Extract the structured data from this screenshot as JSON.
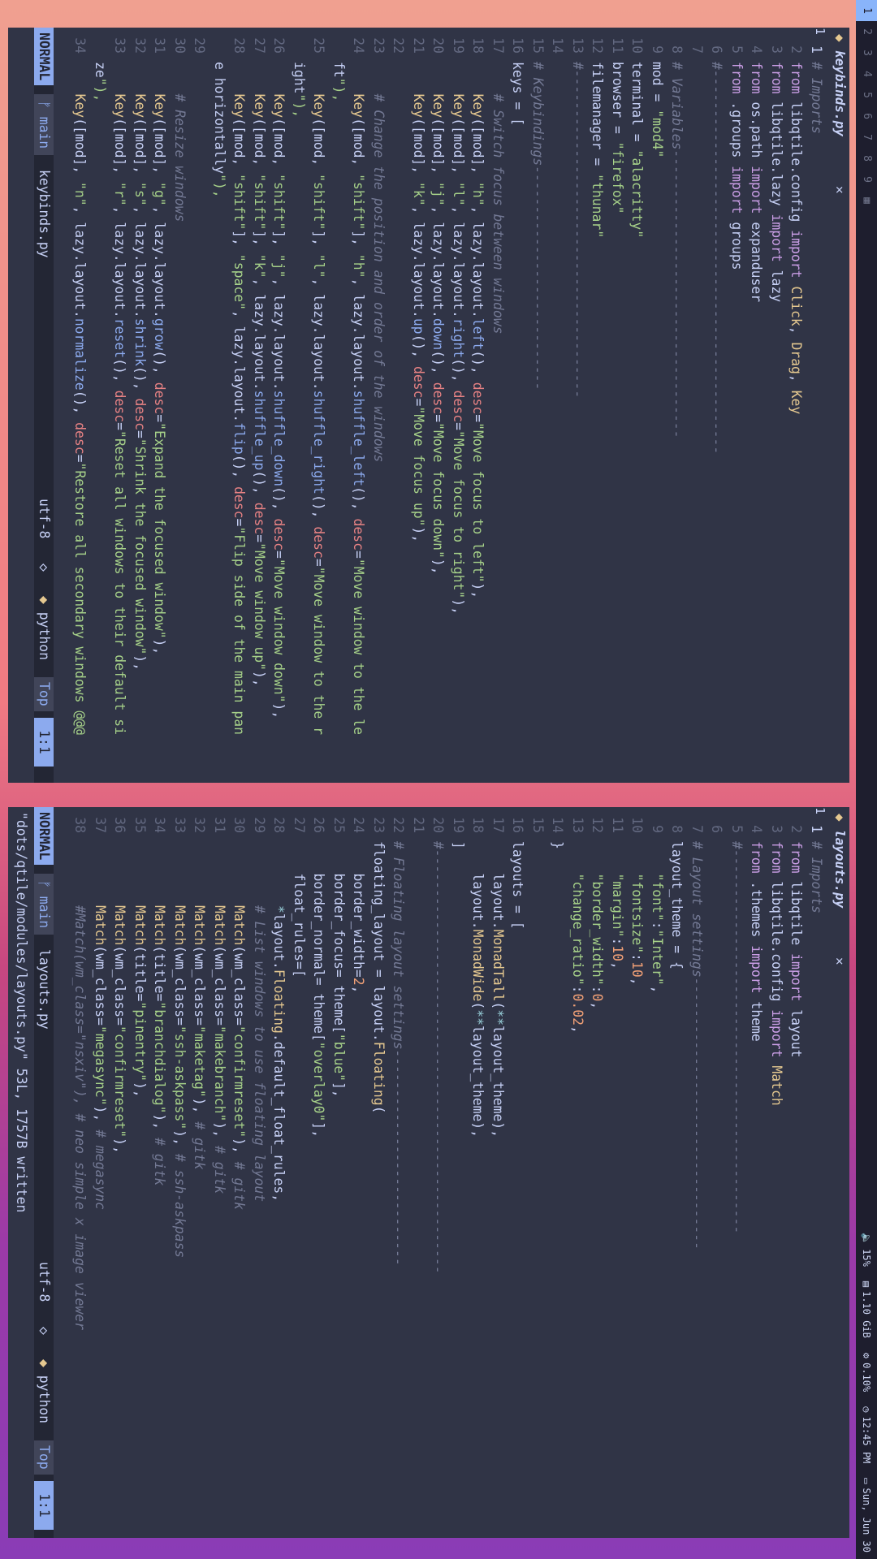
{
  "bar": {
    "workspaces": [
      "1",
      "2",
      "3",
      "4",
      "5",
      "6",
      "7",
      "8",
      "9"
    ],
    "active_workspace": "1",
    "layout_icon": "layout-icon",
    "volume": "15%",
    "memory": "1.10 GiB",
    "cpu": "0.10%",
    "time": "12:45 PM",
    "date": "Sun, Jun 30"
  },
  "left": {
    "tab_title": "keybinds.py",
    "close_glyph": "✕",
    "lines": [
      {
        "n": "1",
        "t": "# Imports"
      },
      {
        "n": "2",
        "t": "from libqtile.config import Click, Drag, Key"
      },
      {
        "n": "3",
        "t": "from libqtile.lazy import lazy"
      },
      {
        "n": "4",
        "t": "from os.path import expanduser"
      },
      {
        "n": "5",
        "t": "from .groups import groups"
      },
      {
        "n": "6",
        "t": "#------------------------------------------------"
      },
      {
        "n": "7",
        "t": ""
      },
      {
        "n": "8",
        "t": "# Variables------------------------------------"
      },
      {
        "n": "9",
        "t": "mod = \"mod4\""
      },
      {
        "n": "10",
        "t": "terminal = \"alacritty\""
      },
      {
        "n": "11",
        "t": "browser = \"firefox\""
      },
      {
        "n": "12",
        "t": "filemanager = \"thunar\""
      },
      {
        "n": "13",
        "t": "#-----------------------------------------"
      },
      {
        "n": "14",
        "t": ""
      },
      {
        "n": "15",
        "t": "# Keybindings----------------------------"
      },
      {
        "n": "16",
        "t": "keys = ["
      },
      {
        "n": "17",
        "t": "    # Switch focus between windows"
      },
      {
        "n": "18",
        "t": "    Key([mod], \"h\", lazy.layout.left(), desc=\"Move focus to left\"),"
      },
      {
        "n": "19",
        "t": "    Key([mod], \"l\", lazy.layout.right(), desc=\"Move focus to right\"),"
      },
      {
        "n": "20",
        "t": "    Key([mod], \"j\", lazy.layout.down(), desc=\"Move focus down\"),"
      },
      {
        "n": "21",
        "t": "    Key([mod], \"k\", lazy.layout.up(), desc=\"Move focus up\"),"
      },
      {
        "n": "22",
        "t": ""
      },
      {
        "n": "23",
        "t": "    # Change the position and order of the windows"
      },
      {
        "n": "24",
        "t": "    Key([mod, \"shift\"], \"h\", lazy.layout.shuffle_left(), desc=\"Move window to the le"
      },
      {
        "n": "",
        "t": "ft\"),"
      },
      {
        "n": "25",
        "t": "    Key([mod, \"shift\"], \"l\", lazy.layout.shuffle_right(), desc=\"Move window to the r"
      },
      {
        "n": "",
        "t": "ight\"),"
      },
      {
        "n": "26",
        "t": "    Key([mod, \"shift\"], \"j\", lazy.layout.shuffle_down(), desc=\"Move window down\"),"
      },
      {
        "n": "27",
        "t": "    Key([mod, \"shift\"], \"k\", lazy.layout.shuffle_up(), desc=\"Move window up\"),"
      },
      {
        "n": "28",
        "t": "    Key([mod, \"shift\"], \"space\", lazy.layout.flip(), desc=\"Flip side of the main pan"
      },
      {
        "n": "",
        "t": "e horizontally\"),"
      },
      {
        "n": "29",
        "t": ""
      },
      {
        "n": "30",
        "t": "    # Resize windows"
      },
      {
        "n": "31",
        "t": "    Key([mod], \"g\", lazy.layout.grow(), desc=\"Expand the focused window\"),"
      },
      {
        "n": "32",
        "t": "    Key([mod], \"s\", lazy.layout.shrink(), desc=\"Shrink the focused window\"),"
      },
      {
        "n": "33",
        "t": "    Key([mod], \"r\", lazy.layout.reset(), desc=\"Reset all windows to their default si"
      },
      {
        "n": "",
        "t": "ze\"),"
      },
      {
        "n": "34",
        "t": "    Key([mod], \"n\", lazy.layout.normalize(), desc=\"Restore all secondary windows @@@"
      }
    ],
    "status": {
      "mode": "NORMAL",
      "branch": "main",
      "file": "keybinds.py",
      "encoding": "utf-8",
      "filetype": "python",
      "scroll": "Top",
      "pos": "1:1"
    },
    "cmd": ""
  },
  "right": {
    "tab_title": "layouts.py",
    "close_glyph": "✕",
    "lines": [
      {
        "n": "1",
        "t": "# Imports"
      },
      {
        "n": "2",
        "t": "from libqtile import layout"
      },
      {
        "n": "3",
        "t": "from libqtile.config import Match"
      },
      {
        "n": "4",
        "t": "from .themes import theme"
      },
      {
        "n": "5",
        "t": "#------------------------------------------------"
      },
      {
        "n": "6",
        "t": ""
      },
      {
        "n": "7",
        "t": "# Layout settings----------------------------------"
      },
      {
        "n": "8",
        "t": "layout_theme = {"
      },
      {
        "n": "9",
        "t": "    \"font\":\"Inter\","
      },
      {
        "n": "10",
        "t": "    \"fontsize\":10,"
      },
      {
        "n": "11",
        "t": "    \"margin\":10,"
      },
      {
        "n": "12",
        "t": "    \"border_width\":0,"
      },
      {
        "n": "13",
        "t": "    \"change_ratio\":0.02,"
      },
      {
        "n": "14",
        "t": "}"
      },
      {
        "n": "15",
        "t": ""
      },
      {
        "n": "16",
        "t": "layouts = ["
      },
      {
        "n": "17",
        "t": "    layout.MonadTall(**layout_theme),"
      },
      {
        "n": "18",
        "t": "    layout.MonadWide(**layout_theme),"
      },
      {
        "n": "19",
        "t": "]"
      },
      {
        "n": "20",
        "t": "#-----------------------------------------------------"
      },
      {
        "n": "21",
        "t": ""
      },
      {
        "n": "22",
        "t": "# Floating layout settings---------------------------"
      },
      {
        "n": "23",
        "t": "floating_layout = layout.Floating("
      },
      {
        "n": "24",
        "t": "    border_width=2,"
      },
      {
        "n": "25",
        "t": "    border_focus= theme[\"blue\"],"
      },
      {
        "n": "26",
        "t": "    border_normal= theme[\"overlay0\"],"
      },
      {
        "n": "27",
        "t": "    float_rules=["
      },
      {
        "n": "28",
        "t": "        *layout.Floating.default_float_rules,"
      },
      {
        "n": "29",
        "t": "        # List windows to use floating layout"
      },
      {
        "n": "30",
        "t": "        Match(wm_class=\"confirmreset\"), # gitk"
      },
      {
        "n": "31",
        "t": "        Match(wm_class=\"makebranch\"), # gitk"
      },
      {
        "n": "32",
        "t": "        Match(wm_class=\"maketag\"), # gitk"
      },
      {
        "n": "33",
        "t": "        Match(wm_class=\"ssh-askpass\"), # ssh-askpass"
      },
      {
        "n": "34",
        "t": "        Match(title=\"branchdialog\"), # gitk"
      },
      {
        "n": "35",
        "t": "        Match(title=\"pinentry\"),"
      },
      {
        "n": "36",
        "t": "        Match(wm_class=\"confirmreset\"),"
      },
      {
        "n": "37",
        "t": "        Match(wm_class=\"megasync\"), # megasync"
      },
      {
        "n": "38",
        "t": "        #Match(wm_class=\"nsxiv\"), # neo simple x image viewer"
      }
    ],
    "status": {
      "mode": "NORMAL",
      "branch": "main",
      "file": "layouts.py",
      "encoding": "utf-8",
      "filetype": "python",
      "scroll": "Top",
      "pos": "1:1"
    },
    "cmd": "\"dots/qtile/modules/layouts.py\" 53L, 1757B written"
  },
  "colors": {
    "bg": "#303446",
    "keyword": "#ca9ee6",
    "string": "#a6d189",
    "comment": "#737994",
    "accent": "#8caaee"
  }
}
